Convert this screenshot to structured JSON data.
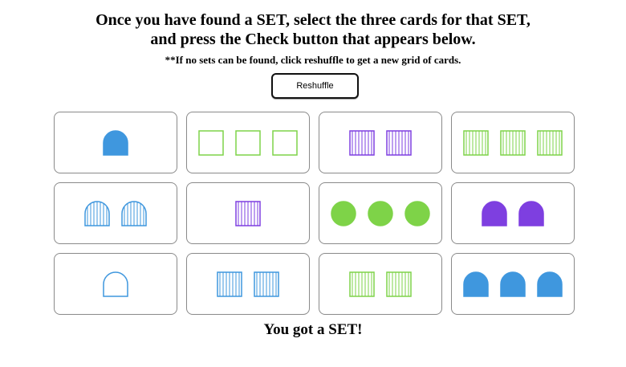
{
  "instructions": {
    "line1": "Once you have found a SET, select the three cards for that SET,",
    "line2": "and press the Check button that appears below."
  },
  "note": "**If no sets can be found, click reshuffle to get a new grid of cards.",
  "reshuffle_label": "Reshuffle",
  "result_message": "You got a SET!",
  "colors": {
    "green": "#7ed348",
    "purple": "#7e3fe0",
    "blue": "#3f97de"
  },
  "cards": [
    {
      "shape": "arch",
      "color": "blue",
      "fill": "solid",
      "count": 1
    },
    {
      "shape": "square",
      "color": "green",
      "fill": "empty",
      "count": 3
    },
    {
      "shape": "square",
      "color": "purple",
      "fill": "striped",
      "count": 2
    },
    {
      "shape": "square",
      "color": "green",
      "fill": "striped",
      "count": 3
    },
    {
      "shape": "arch",
      "color": "blue",
      "fill": "striped",
      "count": 2
    },
    {
      "shape": "square",
      "color": "purple",
      "fill": "striped",
      "count": 1
    },
    {
      "shape": "circle",
      "color": "green",
      "fill": "solid",
      "count": 3
    },
    {
      "shape": "arch",
      "color": "purple",
      "fill": "solid",
      "count": 2
    },
    {
      "shape": "arch",
      "color": "blue",
      "fill": "empty",
      "count": 1
    },
    {
      "shape": "square",
      "color": "blue",
      "fill": "striped",
      "count": 2
    },
    {
      "shape": "square",
      "color": "green",
      "fill": "striped",
      "count": 2
    },
    {
      "shape": "arch",
      "color": "blue",
      "fill": "solid",
      "count": 3
    }
  ]
}
